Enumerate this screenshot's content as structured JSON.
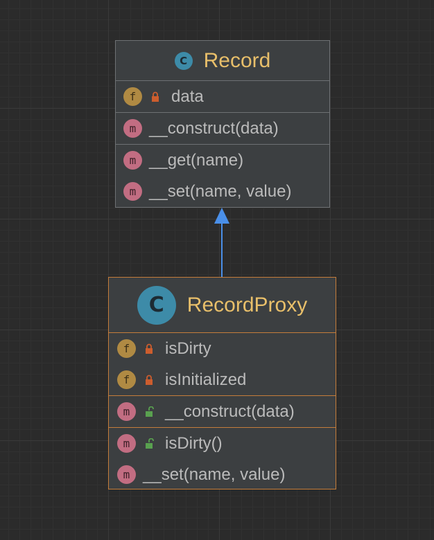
{
  "record": {
    "name": "Record",
    "class_icon": "C",
    "fields": [
      {
        "badge": "f",
        "visibility": "private",
        "name": "data"
      }
    ],
    "constructors": [
      {
        "badge": "m",
        "visibility": "none",
        "name": "__construct(data)"
      }
    ],
    "methods": [
      {
        "badge": "m",
        "visibility": "none",
        "name": "__get(name)"
      },
      {
        "badge": "m",
        "visibility": "none",
        "name": "__set(name, value)"
      }
    ]
  },
  "proxy": {
    "name": "RecordProxy",
    "class_icon": "C",
    "fields": [
      {
        "badge": "f",
        "visibility": "private",
        "name": "isDirty"
      },
      {
        "badge": "f",
        "visibility": "private",
        "name": "isInitialized"
      }
    ],
    "constructors": [
      {
        "badge": "m",
        "visibility": "public",
        "name": "__construct(data)"
      }
    ],
    "methods": [
      {
        "badge": "m",
        "visibility": "public",
        "name": "isDirty()"
      },
      {
        "badge": "m",
        "visibility": "none",
        "name": "__set(name, value)"
      }
    ]
  },
  "relation": {
    "type": "inheritance",
    "from": "RecordProxy",
    "to": "Record"
  },
  "colors": {
    "class_name": "#e8bf6a",
    "class_icon": "#3d8ba8",
    "field_badge": "#b08a43",
    "method_badge": "#c26d82",
    "private_lock": "#cc5d2e",
    "public_lock": "#59a14f",
    "arrow": "#4a8fe8",
    "selected_border": "#c57d3b"
  }
}
